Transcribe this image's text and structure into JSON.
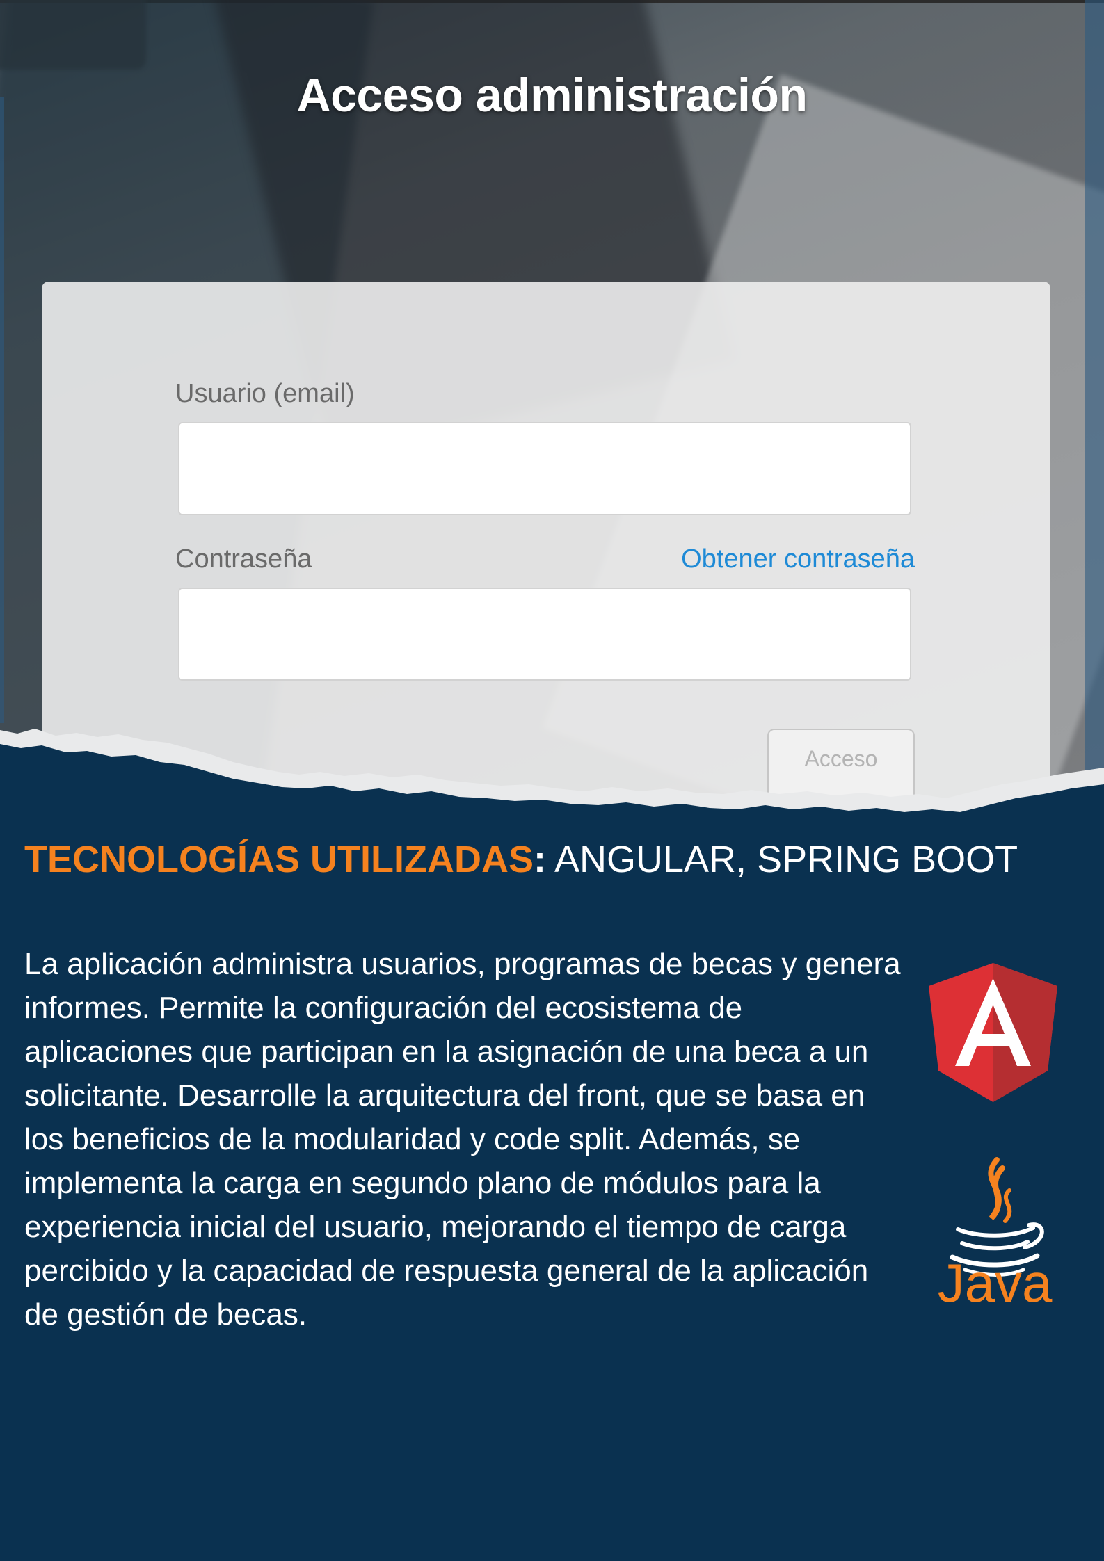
{
  "login": {
    "title": "Acceso administración",
    "user_label": "Usuario (email)",
    "password_label": "Contraseña",
    "forgot_link": "Obtener contraseña",
    "submit_label": "Acceso"
  },
  "tech": {
    "label": "TECNOLOGÍAS UTILIZADAS",
    "separator": ":",
    "value": " ANGULAR, SPRING BOOT"
  },
  "description": "La aplicación administra usuarios, programas de becas y genera informes. Permite la configuración del ecosistema de aplicaciones que participan en la asignación de una beca a un solicitante. Desarrolle la arquitectura del front, que se basa en los beneficios de la modularidad y code split. Además, se implementa la carga en segundo plano de módulos para la experiencia inicial del usuario, mejorando el tiempo de carga percibido y la capacidad de respuesta general de la aplicación de gestión de becas.",
  "logos": {
    "angular_icon": "angular-logo-icon",
    "java_icon": "java-logo-icon",
    "java_text": "Java"
  },
  "colors": {
    "panel_background": "#0a3150",
    "accent_orange": "#f5821f",
    "link_blue": "#1e8ad6",
    "angular_red": "#dd3035",
    "angular_dark_red": "#b52e31"
  }
}
